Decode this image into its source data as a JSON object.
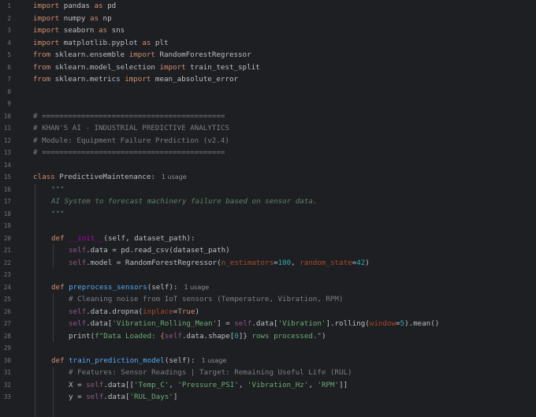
{
  "editor": {
    "line_numbers": [
      "1",
      "2",
      "3",
      "4",
      "5",
      "6",
      "7",
      "8",
      "9",
      "10",
      "11",
      "12",
      "13",
      "14",
      "15",
      "16",
      "17",
      "18",
      "19",
      "20",
      "21",
      "22",
      "23",
      "24",
      "25",
      "26",
      "27",
      "28",
      "29",
      "30",
      "31",
      "32",
      "33"
    ],
    "usage_hint": "1 usage",
    "imports": {
      "l1": {
        "kw": "import",
        "mod": " pandas ",
        "as": "as",
        "alias": " pd"
      },
      "l2": {
        "kw": "import",
        "mod": " numpy ",
        "as": "as",
        "alias": " np"
      },
      "l3": {
        "kw": "import",
        "mod": " seaborn ",
        "as": "as",
        "alias": " sns"
      },
      "l4": {
        "kw": "import",
        "mod": " matplotlib.pyplot ",
        "as": "as",
        "alias": " plt"
      },
      "l5": {
        "kw": "from",
        "mod": " sklearn.ensemble ",
        "imp": "import",
        "name": " RandomForestRegressor"
      },
      "l6": {
        "kw": "from",
        "mod": " sklearn.model_selection ",
        "imp": "import",
        "name": " train_test_split"
      },
      "l7": {
        "kw": "from",
        "mod": " sklearn.metrics ",
        "imp": "import",
        "name": " mean_absolute_error"
      }
    },
    "comments": {
      "l10": "# ==========================================",
      "l11": "# KHAN'S AI - INDUSTRIAL PREDICTIVE ANALYTICS",
      "l12": "# Module: Equipment Failure Prediction (v2.4)",
      "l13": "# =========================================="
    },
    "class_line": {
      "kw": "class",
      "name": " PredictiveMaintenance",
      "colon": ":"
    },
    "docstring": {
      "open": "\"\"\"",
      "text": "AI System to forecast machinery failure based on sensor data.",
      "close": "\"\"\""
    },
    "init": {
      "def": "def",
      "space": " ",
      "name": "__init__",
      "sig": "(self, dataset_path):",
      "l21_a": "self",
      "l21_b": ".data = pd.read_csv(dataset_path)",
      "l22_a": "self",
      "l22_b": ".model = RandomForestRegressor(",
      "l22_p1": "n_estimators",
      "l22_eq1": "=",
      "l22_n1": "100",
      "l22_c": ", ",
      "l22_p2": "random_state",
      "l22_eq2": "=",
      "l22_n2": "42",
      "l22_end": ")"
    },
    "preprocess": {
      "def": "def",
      "name": " preprocess_sensors",
      "sig": "(self):",
      "l25": "# Cleaning noise from IoT sensors (Temperature, Vibration, RPM)",
      "l26_a": "self",
      "l26_b": ".data.dropna(",
      "l26_p": "inplace",
      "l26_eq": "=",
      "l26_v": "True",
      "l26_end": ")",
      "l27_a": "self",
      "l27_b": ".data[",
      "l27_s1": "'Vibration_Rolling_Mean'",
      "l27_c": "] = ",
      "l27_self2": "self",
      "l27_d": ".data[",
      "l27_s2": "'Vibration'",
      "l27_e": "].rolling(",
      "l27_p": "window",
      "l27_eq": "=",
      "l27_n": "5",
      "l27_end": ").mean()",
      "l28_fn": "print",
      "l28_a": "(",
      "l28_s1": "f\"Data Loaded: ",
      "l28_b": "{",
      "l28_self": "self",
      "l28_c": ".data.shape[",
      "l28_n": "0",
      "l28_d": "]}",
      "l28_s2": " rows processed.\"",
      "l28_end": ")"
    },
    "train": {
      "def": "def",
      "name": " train_prediction_model",
      "sig": "(self):",
      "l31": "# Features: Sensor Readings | Target: Remaining Useful Life (RUL)",
      "l32_a": "X = ",
      "l32_self": "self",
      "l32_b": ".data[[",
      "l32_s1": "'Temp_C'",
      "l32_c1": ", ",
      "l32_s2": "'Pressure_PSI'",
      "l32_c2": ", ",
      "l32_s3": "'Vibration_Hz'",
      "l32_c3": ", ",
      "l32_s4": "'RPM'",
      "l32_end": "]]",
      "l33_a": "y = ",
      "l33_self": "self",
      "l33_b": ".data[",
      "l33_s": "'RUL_Days'",
      "l33_end": "]"
    }
  },
  "colors": {
    "background": "#1e1f22",
    "keyword": "#cf8e6d",
    "comment": "#7a7e85",
    "function": "#56a8f5",
    "self": "#94558d",
    "string": "#6aab73",
    "number": "#2aacb8",
    "parameter": "#aa4926",
    "docstring": "#5f826b"
  }
}
